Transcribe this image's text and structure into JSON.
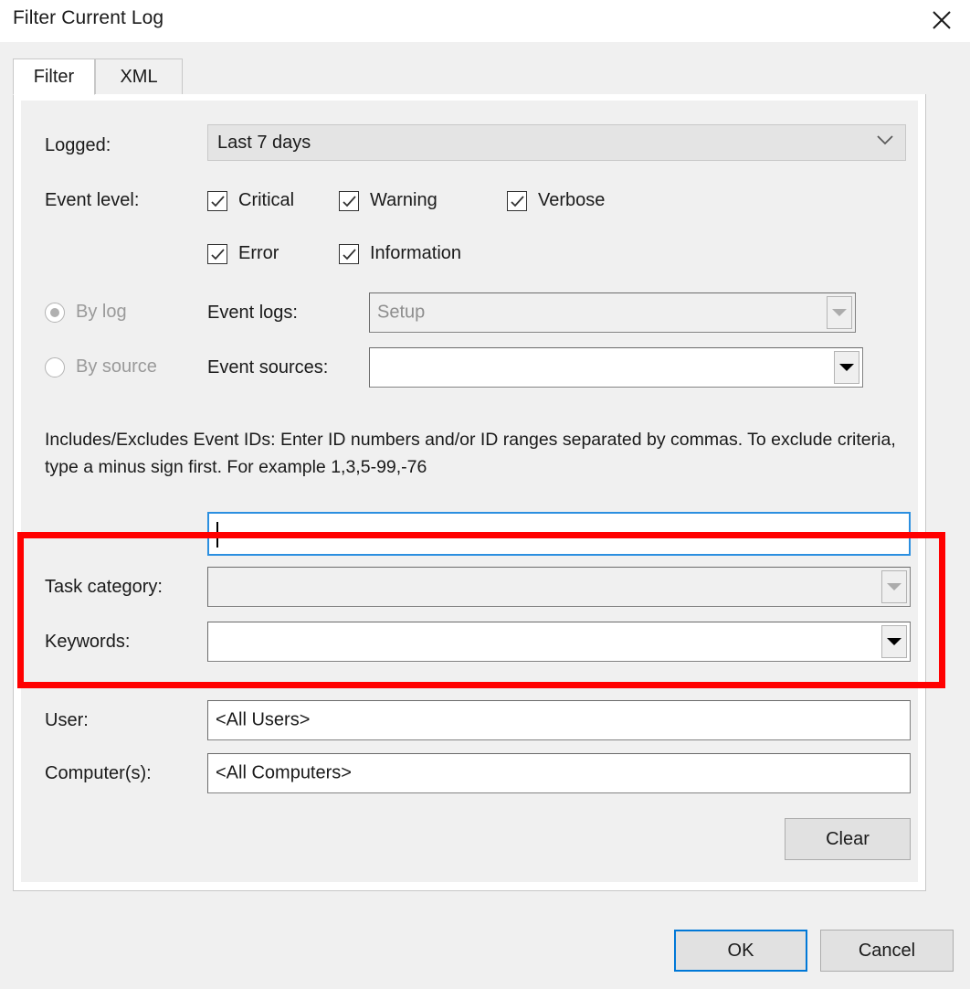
{
  "window": {
    "title": "Filter Current Log",
    "close_icon": "close-icon"
  },
  "tabs": [
    {
      "label": "Filter",
      "active": true
    },
    {
      "label": "XML",
      "active": false
    }
  ],
  "form": {
    "logged": {
      "label": "Logged:",
      "value": "Last 7 days",
      "icon": "chevron-down-icon"
    },
    "event_level": {
      "label": "Event level:",
      "checkboxes": [
        {
          "label": "Critical",
          "checked": true
        },
        {
          "label": "Warning",
          "checked": true
        },
        {
          "label": "Verbose",
          "checked": true
        },
        {
          "label": "Error",
          "checked": true
        },
        {
          "label": "Information",
          "checked": true
        }
      ]
    },
    "source_mode": {
      "by_log": {
        "label": "By log",
        "selected": true,
        "disabled": true
      },
      "by_source": {
        "label": "By source",
        "selected": false,
        "disabled": true
      }
    },
    "event_logs": {
      "label": "Event logs:",
      "value": "Setup",
      "disabled": true,
      "icon": "triangle-down-icon"
    },
    "event_sources": {
      "label": "Event sources:",
      "value": "",
      "disabled": false,
      "icon": "triangle-down-icon"
    },
    "event_ids_help": "Includes/Excludes Event IDs: Enter ID numbers and/or ID ranges separated by commas. To exclude criteria, type a minus sign first. For example 1,3,5-99,-76",
    "event_ids": {
      "value": "",
      "focused": true
    },
    "task_category": {
      "label": "Task category:",
      "value": "",
      "disabled": true,
      "icon": "triangle-down-icon"
    },
    "keywords": {
      "label": "Keywords:",
      "value": "",
      "disabled": false,
      "icon": "triangle-down-icon"
    },
    "user": {
      "label": "User:",
      "value": "<All Users>"
    },
    "computers": {
      "label": "Computer(s):",
      "value": "<All Computers>"
    },
    "clear_button": "Clear"
  },
  "footer": {
    "ok_label": "OK",
    "cancel_label": "Cancel"
  },
  "annotation": {
    "color": "#ff0000",
    "highlights": [
      "Task category:",
      "Keywords:"
    ]
  }
}
